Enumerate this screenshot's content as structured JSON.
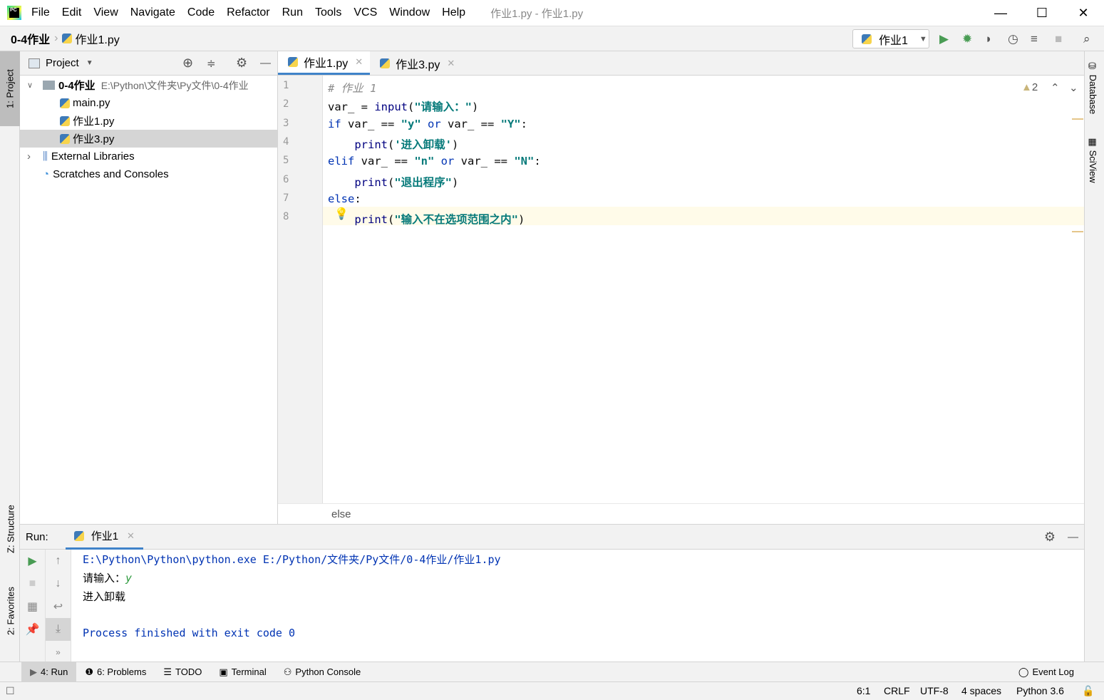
{
  "menu": [
    "File",
    "Edit",
    "View",
    "Navigate",
    "Code",
    "Refactor",
    "Run",
    "Tools",
    "VCS",
    "Window",
    "Help"
  ],
  "window_title": "作业1.py - 作业1.py",
  "breadcrumb": {
    "project": "0-4作业",
    "file": "作业1.py"
  },
  "run_config": "作业1",
  "project_panel": {
    "title": "Project",
    "root": "0-4作业",
    "root_path": "E:\\Python\\文件夹\\Py文件\\0-4作业",
    "files": [
      "main.py",
      "作业1.py",
      "作业3.py"
    ],
    "external": "External Libraries",
    "scratches": "Scratches and Consoles"
  },
  "left_tabs": {
    "project": "1: Project",
    "structure": "Z: Structure",
    "favorites": "2: Favorites"
  },
  "right_tabs": {
    "database": "Database",
    "sciview": "SciView"
  },
  "editor": {
    "tabs": [
      "作业1.py",
      "作业3.py"
    ],
    "warnings": "2",
    "breadcrumb": "else",
    "lines": [
      [
        {
          "t": "# 作业 1",
          "c": "cm"
        }
      ],
      [
        {
          "t": "var_ = ",
          "c": "pl"
        },
        {
          "t": "input",
          "c": "fn"
        },
        {
          "t": "(",
          "c": "pl"
        },
        {
          "t": "\"请输入：\"",
          "c": "str"
        },
        {
          "t": ")",
          "c": "pl"
        }
      ],
      [
        {
          "t": "if ",
          "c": "kw"
        },
        {
          "t": "var_ == ",
          "c": "pl"
        },
        {
          "t": "\"y\"",
          "c": "str"
        },
        {
          "t": " or ",
          "c": "kw"
        },
        {
          "t": "var_ == ",
          "c": "pl"
        },
        {
          "t": "\"Y\"",
          "c": "str"
        },
        {
          "t": ":",
          "c": "pl"
        }
      ],
      [
        {
          "t": "    print",
          "c": "fn"
        },
        {
          "t": "(",
          "c": "pl"
        },
        {
          "t": "'进入卸载'",
          "c": "str"
        },
        {
          "t": ")",
          "c": "pl"
        }
      ],
      [
        {
          "t": "elif ",
          "c": "kw"
        },
        {
          "t": "var_ == ",
          "c": "pl"
        },
        {
          "t": "\"n\"",
          "c": "str"
        },
        {
          "t": " or ",
          "c": "kw"
        },
        {
          "t": "var_ == ",
          "c": "pl"
        },
        {
          "t": "\"N\"",
          "c": "str"
        },
        {
          "t": ":",
          "c": "pl"
        }
      ],
      [
        {
          "t": "    print",
          "c": "fn"
        },
        {
          "t": "(",
          "c": "pl"
        },
        {
          "t": "\"退出程序\"",
          "c": "str"
        },
        {
          "t": ")",
          "c": "pl"
        }
      ],
      [
        {
          "t": "else",
          "c": "kw"
        },
        {
          "t": ":",
          "c": "pl"
        }
      ],
      [
        {
          "t": "    print",
          "c": "fn"
        },
        {
          "t": "(",
          "c": "pl"
        },
        {
          "t": "\"输入不在选项范围之内\"",
          "c": "str"
        },
        {
          "t": ")",
          "c": "pl"
        }
      ]
    ]
  },
  "run": {
    "label": "Run:",
    "tab": "作业1",
    "command": "E:\\Python\\Python\\python.exe E:/Python/文件夹/Py文件/0-4作业/作业1.py",
    "prompt": "请输入：",
    "input": "y",
    "result": "进入卸载",
    "finished": "Process finished with exit code 0"
  },
  "bottom_tabs": [
    "4: Run",
    "6: Problems",
    "TODO",
    "Terminal",
    "Python Console"
  ],
  "event_log": "Event Log",
  "status": {
    "position": "6:1",
    "line_sep": "CRLF",
    "encoding": "UTF-8",
    "indent": "4 spaces",
    "interpreter": "Python 3.6"
  },
  "colors": {
    "accent": "#4083c9",
    "run_green": "#499c54",
    "keyword": "#0033b3",
    "string": "#067a7a"
  }
}
